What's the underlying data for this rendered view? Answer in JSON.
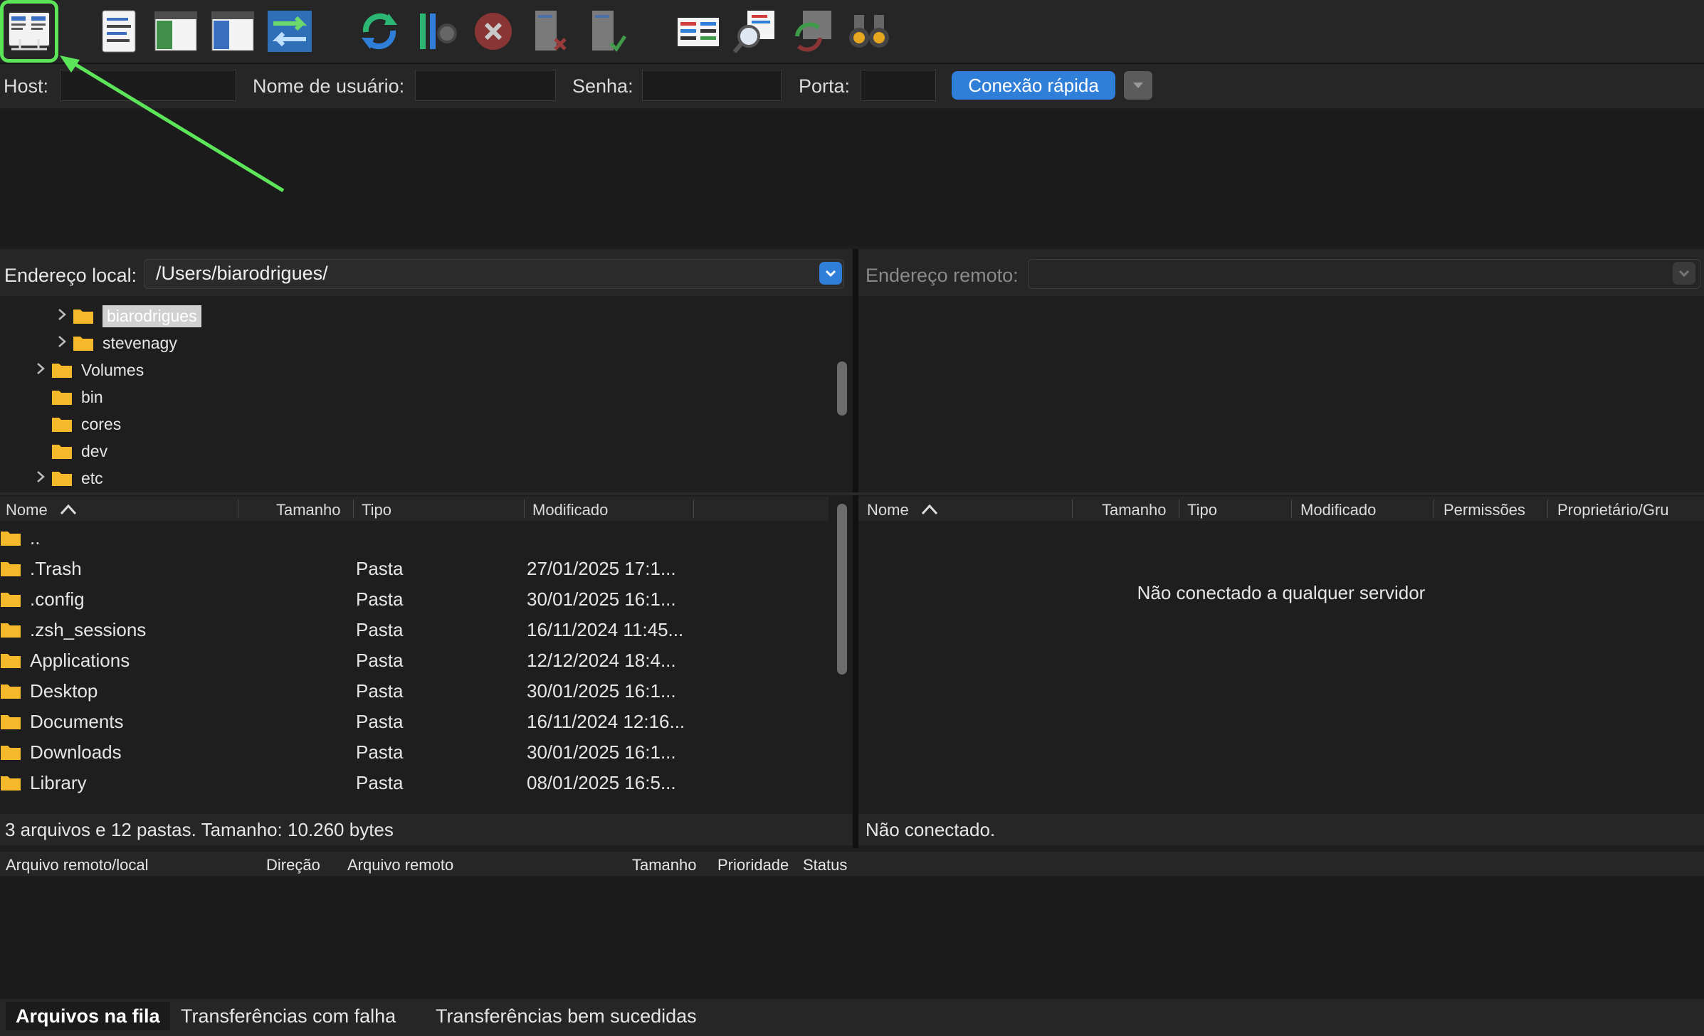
{
  "toolbar": {
    "icons": [
      "site-manager-icon",
      "message-log-icon",
      "local-tree-icon",
      "remote-tree-icon",
      "transfer-queue-icon",
      "refresh-icon",
      "filter-icon",
      "cancel-icon",
      "disconnect-icon",
      "reconnect-icon",
      "directory-compare-icon",
      "search-icon",
      "sync-browse-icon",
      "find-files-icon"
    ]
  },
  "quickconnect": {
    "host_label": "Host:",
    "user_label": "Nome de usuário:",
    "password_label": "Senha:",
    "port_label": "Porta:",
    "connect_label": "Conexão rápida",
    "host_value": "",
    "user_value": "",
    "password_value": "",
    "port_value": ""
  },
  "local": {
    "address_label": "Endereço local:",
    "path": "/Users/biarodrigues/",
    "tree": [
      {
        "label": "biarodrigues",
        "level": 2,
        "expandable": true,
        "selected": true
      },
      {
        "label": "stevenagy",
        "level": 2,
        "expandable": true,
        "selected": false
      },
      {
        "label": "Volumes",
        "level": 1,
        "expandable": true,
        "selected": false
      },
      {
        "label": "bin",
        "level": 1,
        "expandable": false,
        "selected": false
      },
      {
        "label": "cores",
        "level": 1,
        "expandable": false,
        "selected": false
      },
      {
        "label": "dev",
        "level": 1,
        "expandable": false,
        "selected": false
      },
      {
        "label": "etc",
        "level": 1,
        "expandable": true,
        "selected": false
      }
    ],
    "columns": {
      "name": "Nome",
      "size": "Tamanho",
      "type": "Tipo",
      "modified": "Modificado"
    },
    "files": [
      {
        "name": "..",
        "size": "",
        "type": "",
        "modified": ""
      },
      {
        "name": ".Trash",
        "size": "",
        "type": "Pasta",
        "modified": "27/01/2025 17:1..."
      },
      {
        "name": ".config",
        "size": "",
        "type": "Pasta",
        "modified": "30/01/2025 16:1..."
      },
      {
        "name": ".zsh_sessions",
        "size": "",
        "type": "Pasta",
        "modified": "16/11/2024 11:45..."
      },
      {
        "name": "Applications",
        "size": "",
        "type": "Pasta",
        "modified": "12/12/2024 18:4..."
      },
      {
        "name": "Desktop",
        "size": "",
        "type": "Pasta",
        "modified": "30/01/2025 16:1..."
      },
      {
        "name": "Documents",
        "size": "",
        "type": "Pasta",
        "modified": "16/11/2024 12:16..."
      },
      {
        "name": "Downloads",
        "size": "",
        "type": "Pasta",
        "modified": "30/01/2025 16:1..."
      },
      {
        "name": "Library",
        "size": "",
        "type": "Pasta",
        "modified": "08/01/2025 16:5..."
      }
    ],
    "status": "3 arquivos e 12 pastas. Tamanho: 10.260 bytes"
  },
  "remote": {
    "address_label": "Endereço remoto:",
    "path": "",
    "columns": {
      "name": "Nome",
      "size": "Tamanho",
      "type": "Tipo",
      "modified": "Modificado",
      "permissions": "Permissões",
      "owner": "Proprietário/Gru"
    },
    "empty_message": "Não conectado a qualquer servidor",
    "status": "Não conectado."
  },
  "queue": {
    "columns": {
      "local_file": "Arquivo remoto/local",
      "direction": "Direção",
      "remote_file": "Arquivo remoto",
      "size": "Tamanho",
      "priority": "Prioridade",
      "status": "Status"
    },
    "tabs": [
      "Arquivos na fila",
      "Transferências com falha",
      "Transferências bem sucedidas"
    ],
    "active_tab": 0
  },
  "colors": {
    "accent": "#2f7ed8",
    "highlight": "#5de55a",
    "folder": "#f5b82a"
  }
}
